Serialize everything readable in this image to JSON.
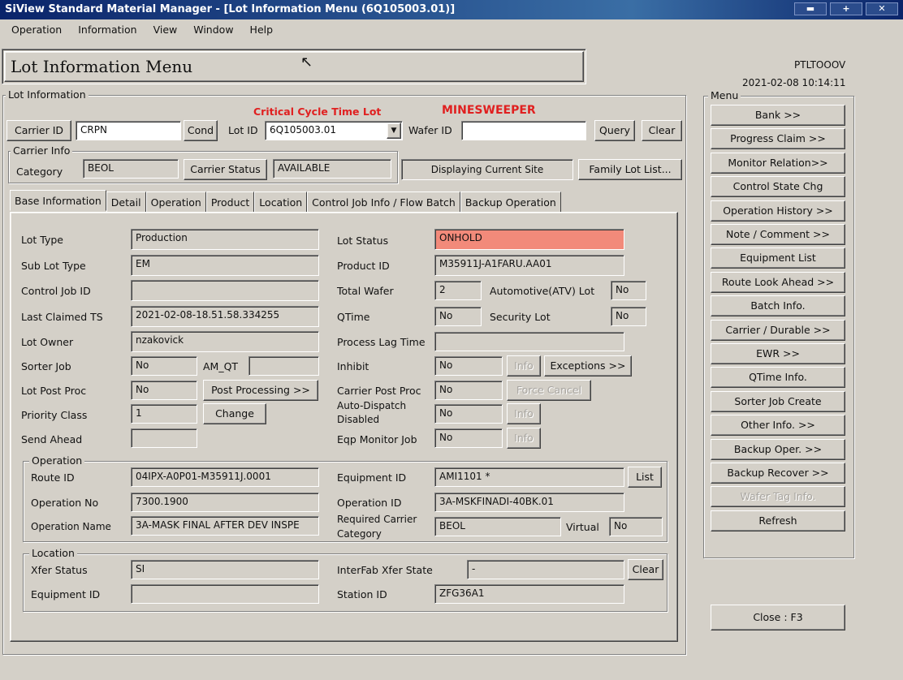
{
  "window": {
    "title": "SiView Standard Material Manager - [Lot Information Menu (6Q105003.01)]"
  },
  "menubar": [
    "Operation",
    "Information",
    "View",
    "Window",
    "Help"
  ],
  "header": {
    "title": "Lot Information Menu",
    "user": "PTLTOOOV",
    "datetime": "2021-02-08 10:14:11"
  },
  "lot_info": {
    "group_label": "Lot Information",
    "critical_label": "Critical Cycle Time Lot",
    "minesweeper_label": "MINESWEEPER",
    "carrier_id_button": "Carrier ID",
    "carrier_id_value": "CRPN",
    "cond_button": "Cond",
    "lot_id_label": "Lot ID",
    "lot_id_value": "6Q105003.01",
    "wafer_id_label": "Wafer ID",
    "wafer_id_value": "",
    "query_button": "Query",
    "clear_button": "Clear"
  },
  "carrier_info": {
    "group_label": "Carrier Info",
    "category_label": "Category",
    "category_value": "BEOL",
    "carrier_status_button": "Carrier Status",
    "carrier_status_value": "AVAILABLE",
    "site_text": "Displaying Current Site",
    "family_button": "Family Lot List..."
  },
  "tabs": [
    "Base Information",
    "Detail",
    "Operation",
    "Product",
    "Location",
    "Control Job Info / Flow Batch",
    "Backup Operation"
  ],
  "base": {
    "lot_type_label": "Lot Type",
    "lot_type": "Production",
    "sub_lot_type_label": "Sub Lot Type",
    "sub_lot_type": "EM",
    "control_job_label": "Control Job ID",
    "control_job": "",
    "last_claimed_label": "Last Claimed TS",
    "last_claimed": "2021-02-08-18.51.58.334255",
    "lot_owner_label": "Lot Owner",
    "lot_owner": "nzakovick",
    "sorter_job_label": "Sorter Job",
    "sorter_job": "No",
    "am_qt_label": "AM_QT",
    "am_qt": "",
    "lot_post_proc_label": "Lot Post Proc",
    "lot_post_proc": "No",
    "post_processing_button": "Post Processing >>",
    "priority_label": "Priority Class",
    "priority": "1",
    "change_button": "Change",
    "send_ahead_label": "Send Ahead",
    "send_ahead": "",
    "lot_status_label": "Lot Status",
    "lot_status": "ONHOLD",
    "product_id_label": "Product ID",
    "product_id": "M35911J-A1FARU.AA01",
    "total_wafer_label": "Total Wafer",
    "total_wafer": "2",
    "automotive_label": "Automotive(ATV) Lot",
    "automotive": "No",
    "qtime_label": "QTime",
    "qtime": "No",
    "security_label": "Security Lot",
    "security": "No",
    "process_lag_label": "Process Lag Time",
    "process_lag": "",
    "inhibit_label": "Inhibit",
    "inhibit": "No",
    "info_button": "Info",
    "exceptions_button": "Exceptions >>",
    "carrier_post_label": "Carrier Post Proc",
    "carrier_post": "No",
    "force_cancel_button": "Force Cancel",
    "auto_dispatch_label_1": "Auto-Dispatch",
    "auto_dispatch_label_2": "Disabled",
    "auto_dispatch": "No",
    "eqp_monitor_label": "Eqp Monitor Job",
    "eqp_monitor": "No"
  },
  "operation": {
    "group_label": "Operation",
    "route_label": "Route ID",
    "route": "04IPX-A0P01-M35911J.0001",
    "op_no_label": "Operation No",
    "op_no": "7300.1900",
    "op_name_label": "Operation Name",
    "op_name": "3A-MASK FINAL AFTER DEV INSPE",
    "equip_label": "Equipment ID",
    "equip": "AMI1101 *",
    "list_button": "List",
    "op_id_label": "Operation ID",
    "op_id": "3A-MSKFINADI-40BK.01",
    "req_carrier_label_1": "Required Carrier",
    "req_carrier_label_2": "Category",
    "req_carrier": "BEOL",
    "virtual_label": "Virtual",
    "virtual": "No"
  },
  "location": {
    "group_label": "Location",
    "xfer_label": "Xfer Status",
    "xfer": "SI",
    "equip_label": "Equipment ID",
    "equip": "",
    "interfab_label": "InterFab Xfer State",
    "interfab": "-",
    "clear_button": "Clear",
    "station_label": "Station ID",
    "station": "ZFG36A1"
  },
  "side_menu": {
    "label": "Menu",
    "items": [
      {
        "label": "Bank >>",
        "enabled": true
      },
      {
        "label": "Progress Claim >>",
        "enabled": true
      },
      {
        "label": "Monitor Relation>>",
        "enabled": true
      },
      {
        "label": "Control State Chg",
        "enabled": true
      },
      {
        "label": "Operation History >>",
        "enabled": true
      },
      {
        "label": "Note / Comment >>",
        "enabled": true
      },
      {
        "label": "Equipment List",
        "enabled": true
      },
      {
        "label": "Route Look Ahead >>",
        "enabled": true
      },
      {
        "label": "Batch Info.",
        "enabled": true
      },
      {
        "label": "Carrier / Durable >>",
        "enabled": true
      },
      {
        "label": "EWR >>",
        "enabled": true
      },
      {
        "label": "QTime Info.",
        "enabled": true
      },
      {
        "label": "Sorter Job Create",
        "enabled": true
      },
      {
        "label": "Other Info. >>",
        "enabled": true
      },
      {
        "label": "Backup Oper. >>",
        "enabled": true
      },
      {
        "label": "Backup Recover >>",
        "enabled": true
      },
      {
        "label": "Wafer Tag Info.",
        "enabled": false
      },
      {
        "label": "Refresh",
        "enabled": true
      }
    ],
    "close_button": "Close : F3"
  },
  "colors": {
    "alert": "#f28a7a",
    "title_bar": "#0a246a",
    "critical_text": "#e02020"
  }
}
